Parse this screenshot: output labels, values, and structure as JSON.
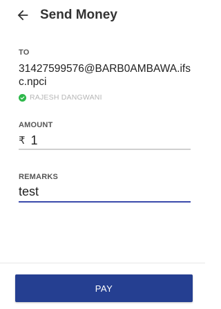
{
  "header": {
    "title": "Send Money",
    "back_icon": "arrow-left-icon"
  },
  "recipient": {
    "label": "TO",
    "vpa": "31427599576@BARB0AMBAWA.ifsc.npci",
    "verified_icon": "check-circle-icon",
    "verified_color": "#2eb84b",
    "name": "RAJESH DANGWANI"
  },
  "amount": {
    "label": "AMOUNT",
    "currency_symbol": "₹",
    "value": "1"
  },
  "remarks": {
    "label": "REMARKS",
    "value": "test",
    "underline_color": "#3949ab"
  },
  "actions": {
    "pay_label": "PAY",
    "pay_color": "#253f91"
  }
}
